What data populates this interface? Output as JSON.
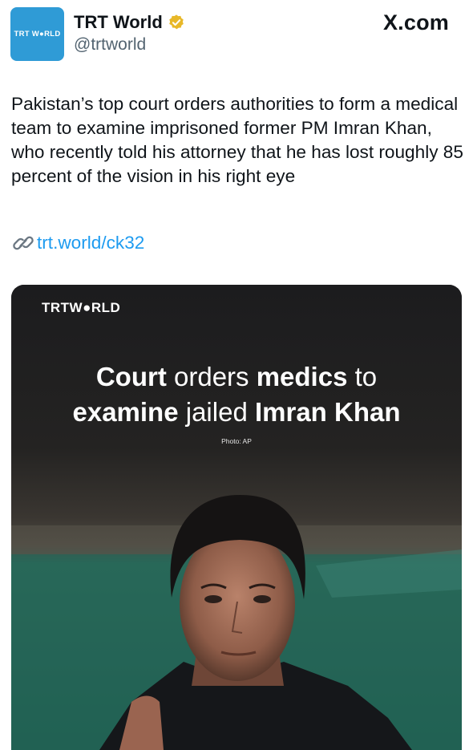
{
  "account": {
    "avatar_text": "TRT W●RLD",
    "display_name": "TRT World",
    "handle": "@trtworld"
  },
  "site_label": "X.com",
  "tweet": {
    "text": "Pakistan’s top court orders authorities to form a medical team to examine imprisoned former PM Imran Khan, who recently told his attorney that he has lost roughly 85 percent of the vision in his right eye",
    "link_text": "trt.world/ck32"
  },
  "media": {
    "brand": "TRTW●RLD",
    "headline": {
      "line1": [
        {
          "text": "Court",
          "bold": true
        },
        {
          "text": " orders ",
          "bold": false
        },
        {
          "text": "medics",
          "bold": true
        },
        {
          "text": " to",
          "bold": false
        }
      ],
      "line2": [
        {
          "text": "examine",
          "bold": true
        },
        {
          "text": " jailed ",
          "bold": false
        },
        {
          "text": "Imran Khan",
          "bold": true
        }
      ]
    },
    "photo_credit": "Photo: AP"
  },
  "colors": {
    "brand_blue": "#2f9bd6",
    "verified_gold": "#e8b829",
    "link_blue": "#1d9bf0",
    "handle_gray": "#536471"
  },
  "icons": [
    "verified-badge-icon",
    "link-icon"
  ]
}
